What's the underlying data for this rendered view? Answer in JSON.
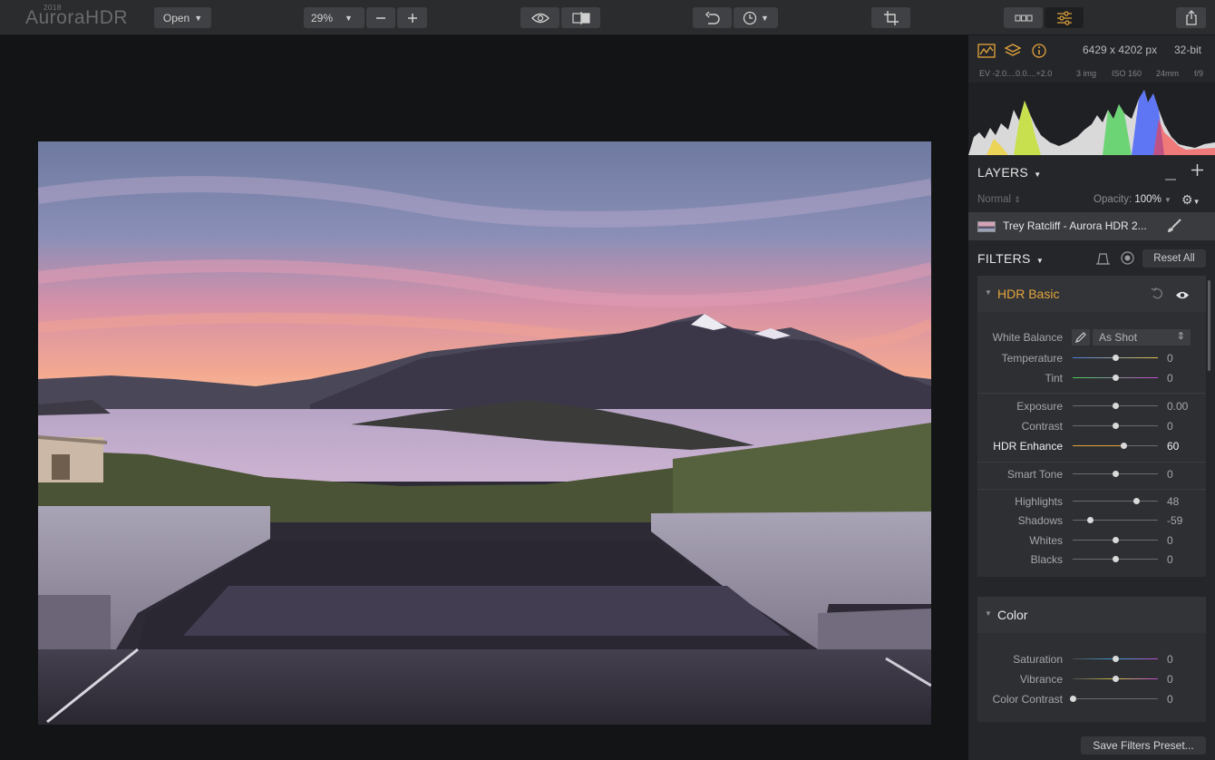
{
  "app": {
    "name": "AuroraHDR",
    "year": "2018"
  },
  "toolbar": {
    "open_label": "Open",
    "zoom_value": "29%"
  },
  "info": {
    "dimensions": "6429 x 4202 px",
    "bit_depth": "32-bit"
  },
  "meta": {
    "ev": "EV  -2.0....0.0....+2.0",
    "images": "3 img",
    "iso": "ISO 160",
    "focal": "24mm",
    "aperture": "f/9"
  },
  "layers": {
    "title": "LAYERS",
    "blend_mode": "Normal",
    "opacity_label": "Opacity:",
    "opacity_value": "100%",
    "layer_name": "Trey Ratcliff - Aurora HDR 2..."
  },
  "filters": {
    "title": "FILTERS",
    "reset_label": "Reset All"
  },
  "hdr_basic": {
    "title": "HDR Basic",
    "white_balance_label": "White Balance",
    "white_balance_value": "As Shot",
    "rows": [
      {
        "label": "Temperature",
        "value": "0",
        "pos": 0.5
      },
      {
        "label": "Tint",
        "value": "0",
        "pos": 0.5
      },
      {
        "label": "Exposure",
        "value": "0.00",
        "pos": 0.5
      },
      {
        "label": "Contrast",
        "value": "0",
        "pos": 0.5
      },
      {
        "label": "HDR Enhance",
        "value": "60",
        "pos": 0.6
      },
      {
        "label": "Smart Tone",
        "value": "0",
        "pos": 0.5
      },
      {
        "label": "Highlights",
        "value": "48",
        "pos": 0.74
      },
      {
        "label": "Shadows",
        "value": "-59",
        "pos": 0.2
      },
      {
        "label": "Whites",
        "value": "0",
        "pos": 0.5
      },
      {
        "label": "Blacks",
        "value": "0",
        "pos": 0.5
      }
    ]
  },
  "color": {
    "title": "Color",
    "rows": [
      {
        "label": "Saturation",
        "value": "0",
        "pos": 0.5
      },
      {
        "label": "Vibrance",
        "value": "0",
        "pos": 0.5
      },
      {
        "label": "Color Contrast",
        "value": "0",
        "pos": 0.0
      }
    ]
  },
  "footer": {
    "save_preset_label": "Save Filters Preset..."
  },
  "colors": {
    "accent": "#e3a53b",
    "panel": "#25262a",
    "toolbar": "#2b2c2e"
  }
}
